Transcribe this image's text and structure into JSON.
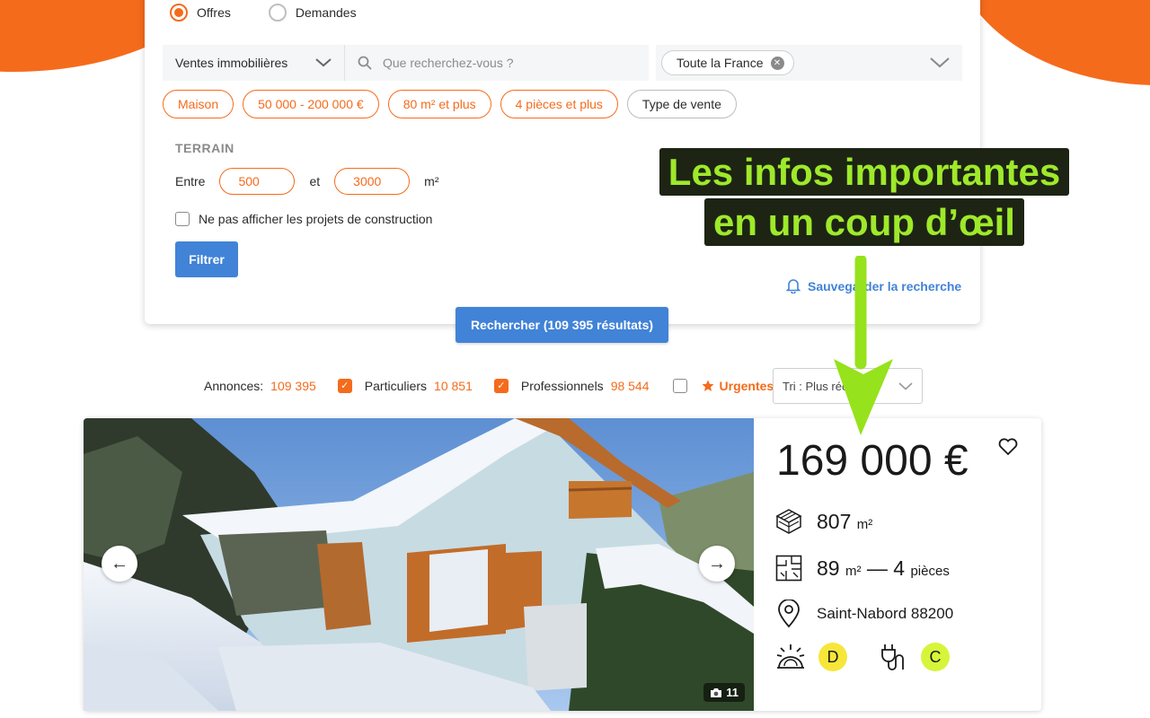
{
  "colors": {
    "accent": "#f56b1c",
    "primary": "#4183d7",
    "energy_d": "#f7e63a",
    "ges_c": "#d6f53a",
    "callout_text": "#9ee92a",
    "callout_bg": "#1d2414"
  },
  "search": {
    "types": [
      {
        "label": "Offres",
        "selected": true
      },
      {
        "label": "Demandes",
        "selected": false
      }
    ],
    "category": "Ventes immobilières",
    "query_placeholder": "Que recherchez-vous ?",
    "location_tag": "Toute la France",
    "chips": [
      "Maison",
      "50 000 - 200 000 €",
      "80 m² et plus",
      "4 pièces et plus",
      "Type de vente"
    ],
    "terrain": {
      "title": "TERRAIN",
      "between": "Entre",
      "min": "500",
      "and": "et",
      "max": "3000",
      "unit": "m²",
      "exclude_label": "Ne pas afficher les projets de construction",
      "filter_button": "Filtrer"
    },
    "save_search": "Sauvegarder la recherche",
    "submit": "Rechercher (109 395 résultats)"
  },
  "results": {
    "annonces_label": "Annonces:",
    "annonces_count": "109 395",
    "particuliers_label": "Particuliers",
    "particuliers_count": "10 851",
    "pros_label": "Professionnels",
    "pros_count": "98 544",
    "urgent_label": "Urgentes",
    "sort": "Tri : Plus récentes"
  },
  "listing": {
    "price": "169 000 €",
    "land_area": "807",
    "land_unit": "m²",
    "living_area": "89",
    "living_unit": "m²",
    "separator": "—",
    "rooms": "4",
    "rooms_unit": "pièces",
    "location": "Saint-Nabord 88200",
    "energy_class": "D",
    "ges_class": "C",
    "photo_count": "11",
    "icons": [
      "arrow-left-icon",
      "arrow-right-icon",
      "camera-icon",
      "heart-icon",
      "land-area-icon",
      "floorplan-icon",
      "location-pin-icon",
      "energy-icon",
      "ges-icon"
    ]
  },
  "callout": {
    "line1": "Les infos importantes",
    "line2": "en un coup d’œil"
  }
}
